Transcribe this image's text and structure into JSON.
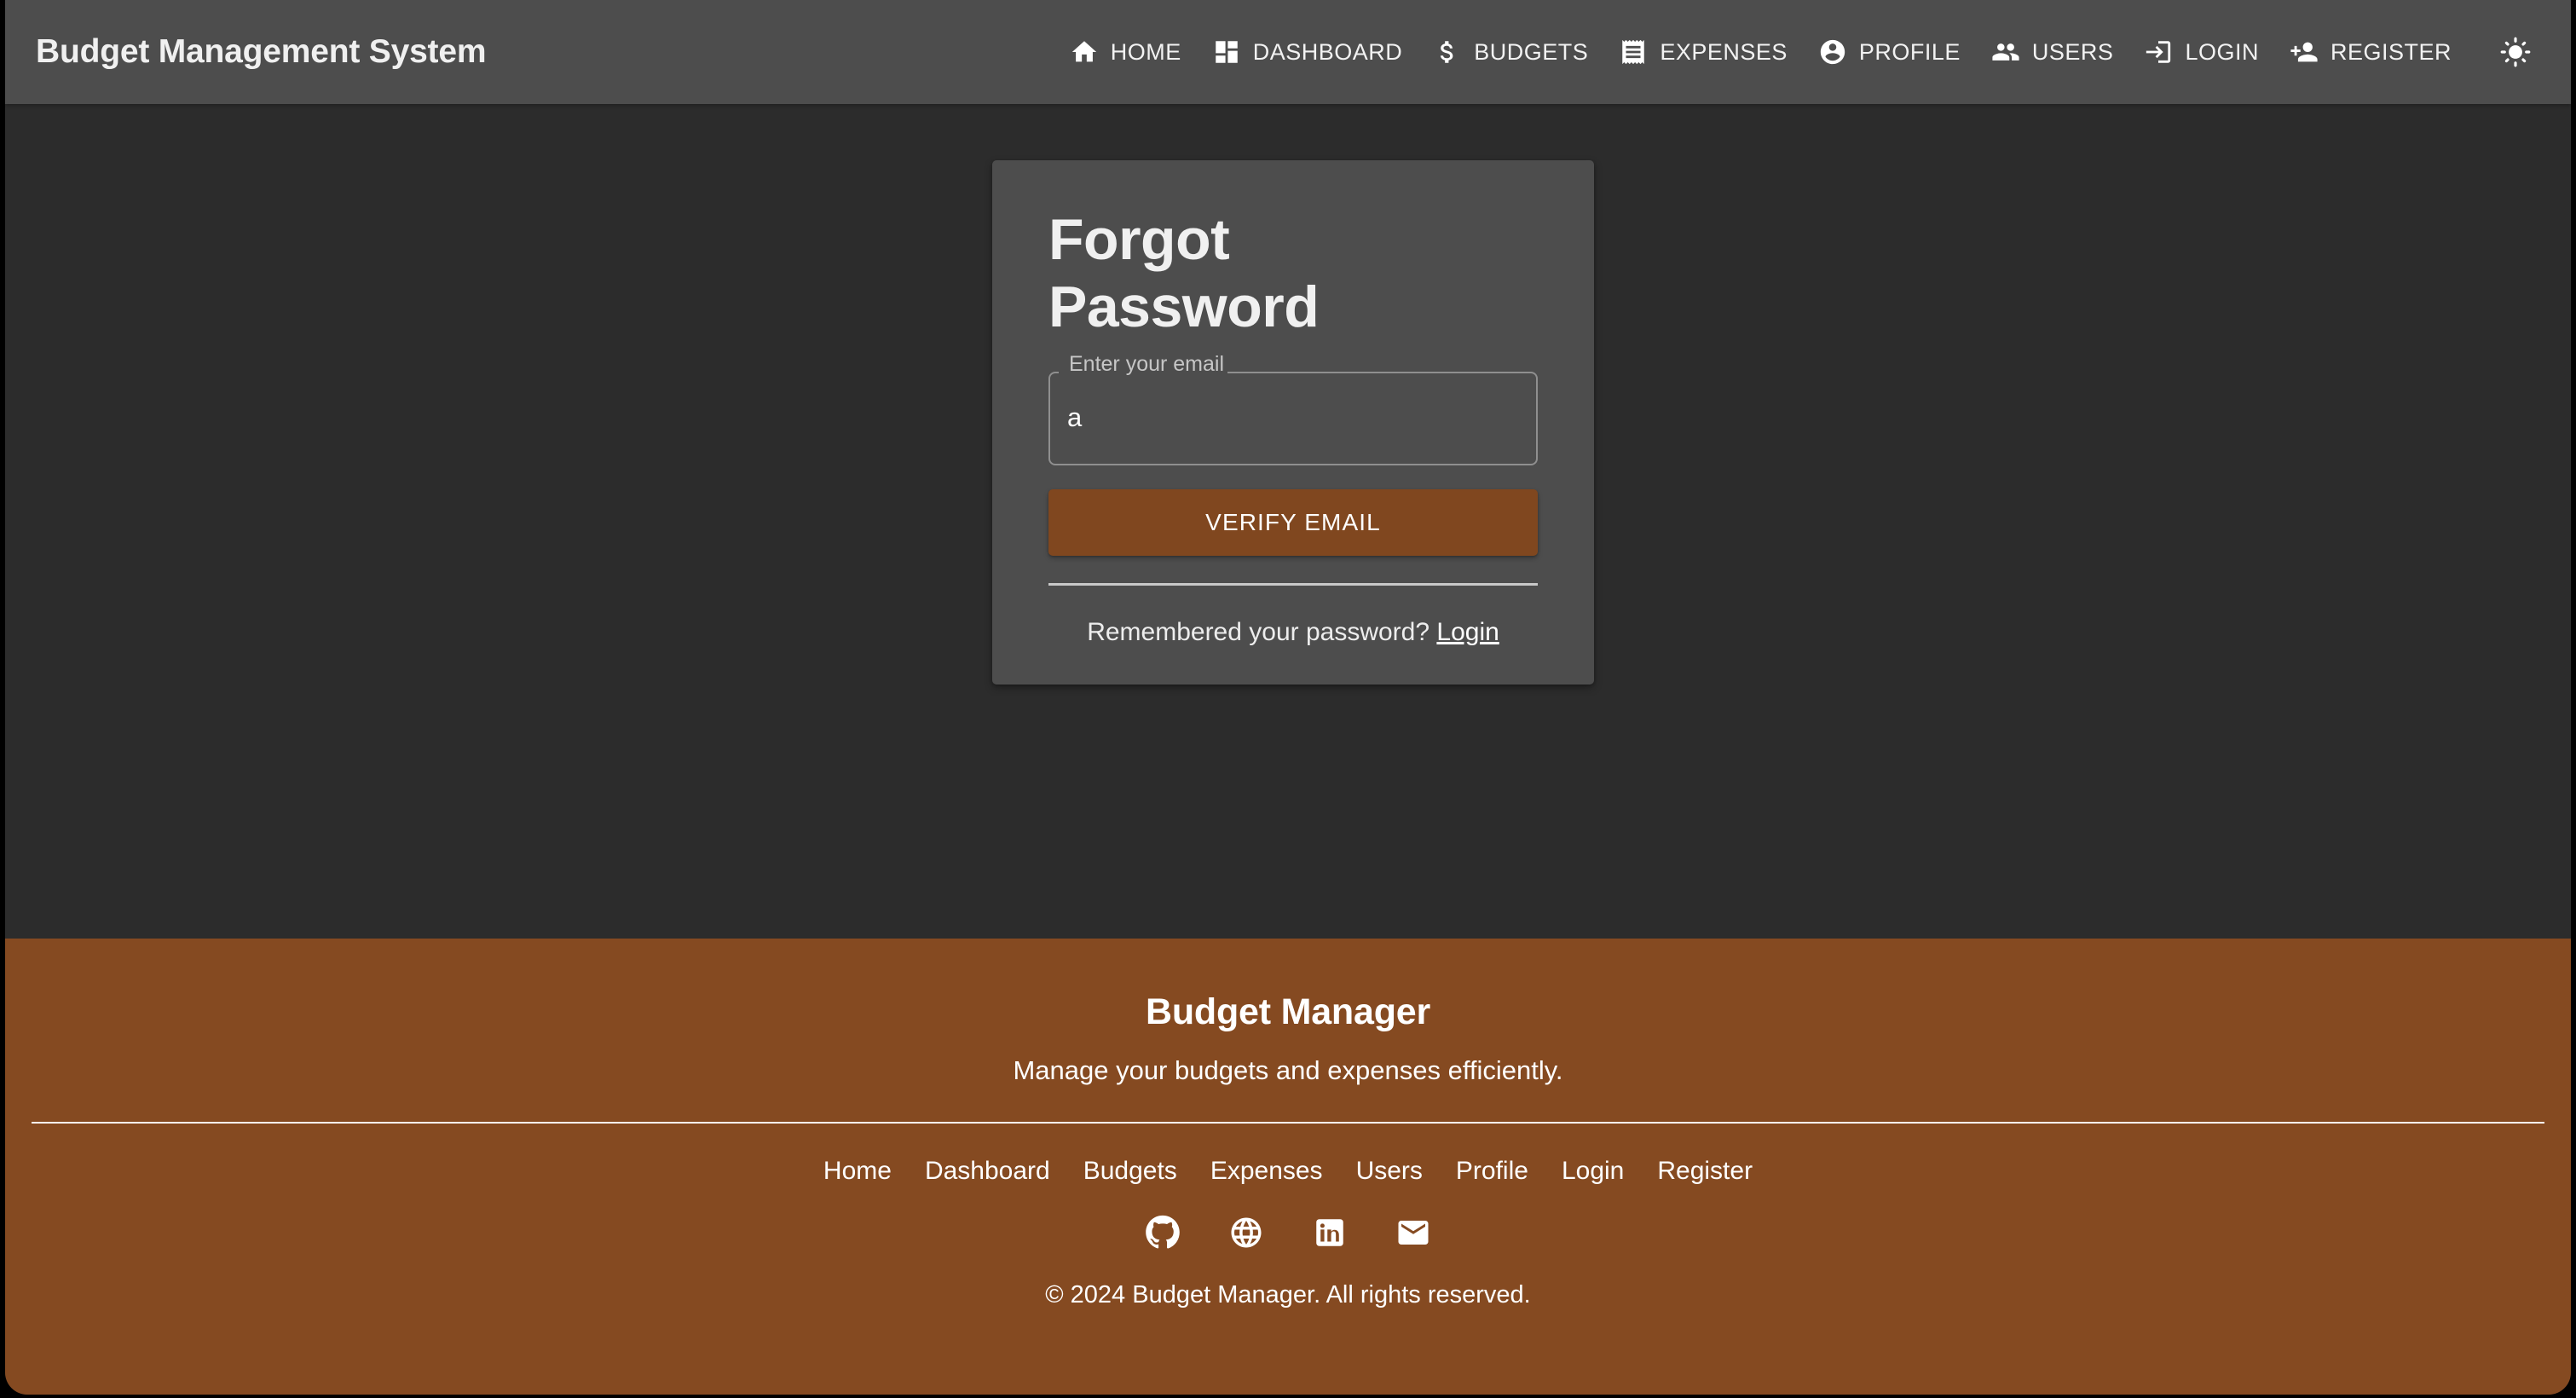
{
  "window": {
    "background": "#2c2c2c"
  },
  "navbar": {
    "brand": "Budget Management System",
    "background": "#4d4d4d",
    "items": [
      {
        "label": "HOME",
        "icon": "home-icon"
      },
      {
        "label": "DASHBOARD",
        "icon": "dashboard-icon"
      },
      {
        "label": "BUDGETS",
        "icon": "dollar-icon"
      },
      {
        "label": "EXPENSES",
        "icon": "receipt-icon"
      },
      {
        "label": "PROFILE",
        "icon": "account-circle-icon"
      },
      {
        "label": "USERS",
        "icon": "people-icon"
      },
      {
        "label": "LOGIN",
        "icon": "login-arrow-icon"
      },
      {
        "label": "REGISTER",
        "icon": "person-add-icon"
      }
    ],
    "theme_toggle": {
      "icon": "sun-icon",
      "title": "Toggle light mode"
    }
  },
  "card": {
    "title": "Forgot Password",
    "background": "#4d4d4d",
    "email_field": {
      "label": "Enter your email",
      "value": "a",
      "placeholder": ""
    },
    "submit_button": {
      "label": "VERIFY EMAIL",
      "color": "#80471f"
    },
    "footer_text": "Remembered your password?",
    "footer_link": "Login"
  },
  "footer": {
    "background": "#854a21",
    "title": "Budget Manager",
    "subtitle": "Manage your budgets and expenses efficiently.",
    "links": [
      "Home",
      "Dashboard",
      "Budgets",
      "Expenses",
      "Users",
      "Profile",
      "Login",
      "Register"
    ],
    "social": [
      {
        "name": "github-icon"
      },
      {
        "name": "globe-icon"
      },
      {
        "name": "linkedin-icon"
      },
      {
        "name": "email-icon"
      }
    ],
    "copyright": "© 2024 Budget Manager. All rights reserved."
  }
}
